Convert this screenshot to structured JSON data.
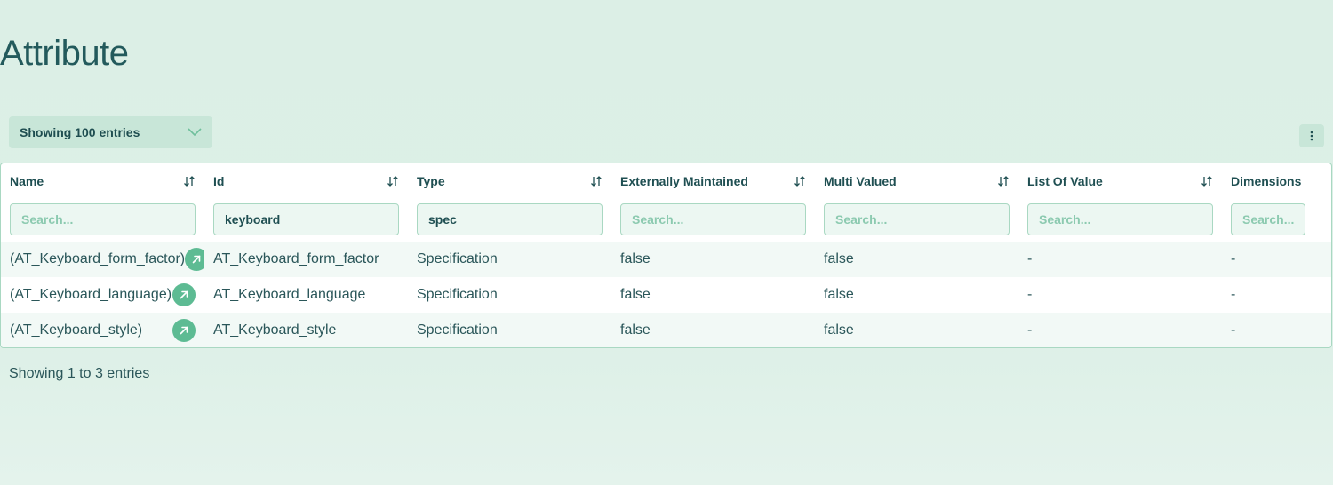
{
  "page": {
    "title": "Attribute"
  },
  "controls": {
    "entries_label": "Showing 100 entries"
  },
  "table": {
    "columns": [
      {
        "label": "Name",
        "filter_value": "",
        "filter_placeholder": "Search..."
      },
      {
        "label": "Id",
        "filter_value": "keyboard",
        "filter_placeholder": "Search..."
      },
      {
        "label": "Type",
        "filter_value": "spec",
        "filter_placeholder": "Search..."
      },
      {
        "label": "Externally Maintained",
        "filter_value": "",
        "filter_placeholder": "Search..."
      },
      {
        "label": "Multi Valued",
        "filter_value": "",
        "filter_placeholder": "Search..."
      },
      {
        "label": "List Of Value",
        "filter_value": "",
        "filter_placeholder": "Search..."
      },
      {
        "label": "Dimensions",
        "filter_value": "",
        "filter_placeholder": "Search..."
      }
    ],
    "rows": [
      [
        "(AT_Keyboard_form_factor)",
        "AT_Keyboard_form_factor",
        "Specification",
        "false",
        "false",
        "-",
        "-"
      ],
      [
        "(AT_Keyboard_language)",
        "AT_Keyboard_language",
        "Specification",
        "false",
        "false",
        "-",
        "-"
      ],
      [
        "(AT_Keyboard_style)",
        "AT_Keyboard_style",
        "Specification",
        "false",
        "false",
        "-",
        "-"
      ]
    ]
  },
  "footer": {
    "info": "Showing 1 to 3 entries"
  },
  "colors": {
    "background": "#dcefe6",
    "accent": "#5dbb93",
    "text": "#1f4f52",
    "border": "#a9d8c2"
  }
}
